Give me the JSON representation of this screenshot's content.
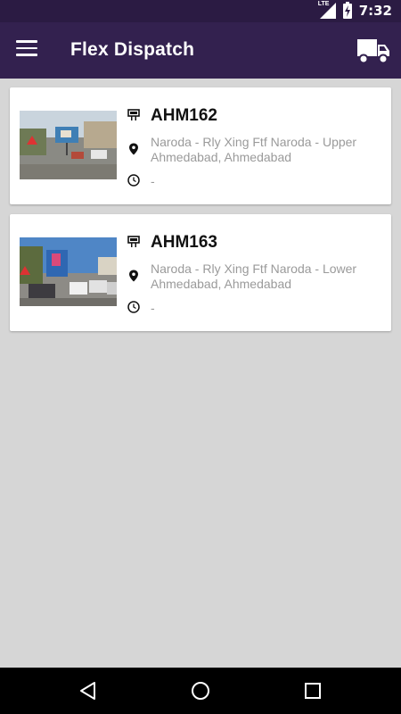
{
  "status_bar": {
    "time": "7:32",
    "network": "LTE"
  },
  "app_bar": {
    "title": "Flex Dispatch"
  },
  "sites": [
    {
      "code": "AHM162",
      "address": "Naroda - Rly Xing Ftf Naroda - Upper Ahmedabad, Ahmedabad",
      "time": "-"
    },
    {
      "code": "AHM163",
      "address": "Naroda - Rly Xing Ftf Naroda - Lower Ahmedabad, Ahmedabad",
      "time": "-"
    }
  ],
  "icons": {
    "menu": "menu-icon",
    "truck": "truck-icon",
    "billboard": "billboard-icon",
    "location": "location-pin-icon",
    "clock": "clock-icon",
    "back": "back-icon",
    "home": "home-icon",
    "recents": "recents-icon"
  },
  "colors": {
    "status_bar": "#2b1b43",
    "app_bar": "#33214f",
    "background": "#d6d6d6",
    "secondary_text": "#9a9a9a"
  }
}
